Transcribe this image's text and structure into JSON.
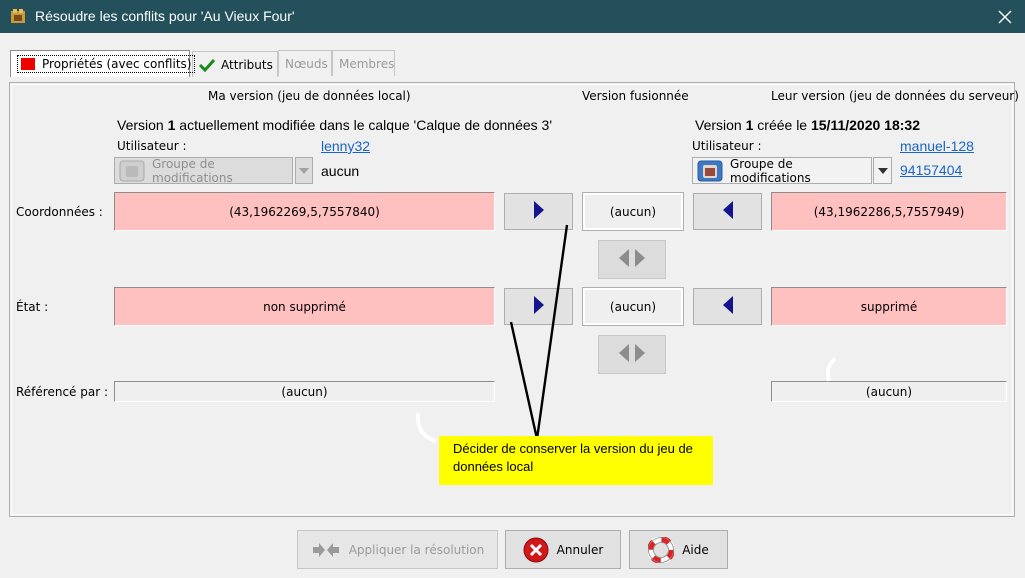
{
  "window": {
    "title": "Résoudre les conflits pour 'Au Vieux Four'",
    "app_icon": "josm-icon",
    "close_icon": "close-icon"
  },
  "tabs": [
    {
      "label": "Propriétés (avec conflits)",
      "icon": "red-square-icon",
      "state": "active"
    },
    {
      "label": "Attributs",
      "icon": "checkmark-icon",
      "state": "enabled"
    },
    {
      "label": "Nœuds",
      "state": "disabled"
    },
    {
      "label": "Membres",
      "state": "disabled"
    }
  ],
  "columns": {
    "mine": "Ma version (jeu de données local)",
    "merged": "Version fusionnée",
    "theirs": "Leur version (jeu de données du serveur)"
  },
  "mine": {
    "version_prefix": "Version",
    "version_number": "1",
    "version_suffix": "actuellement modifiée dans le calque 'Calque de données 3'",
    "user_label": "Utilisateur :",
    "user": "lenny32",
    "changeset_label": "Groupe de modifications",
    "changeset_value": "aucun"
  },
  "theirs": {
    "version_prefix": "Version",
    "version_number": "1",
    "version_middle": "créée le",
    "version_date": "15/11/2020 18:32",
    "user_label": "Utilisateur :",
    "user": "manuel-128",
    "changeset_label": "Groupe de modifications",
    "changeset_value": "94157404"
  },
  "rows": {
    "coords": {
      "label": "Coordonnées :",
      "mine": "(43,1962269,5,7557840)",
      "merged": "(aucun)",
      "theirs": "(43,1962286,5,7557949)"
    },
    "state": {
      "label": "État :",
      "mine": "non supprimé",
      "merged": "(aucun)",
      "theirs": "supprimé"
    },
    "referenced": {
      "label": "Référencé par :",
      "mine": "(aucun)",
      "theirs": "(aucun)"
    }
  },
  "tooltip": "Décider de conserver la version du jeu de données local",
  "buttons": {
    "apply": {
      "label": "Appliquer la résolution",
      "enabled": false,
      "icon": "merge-arrows-icon"
    },
    "cancel": {
      "label": "Annuler",
      "enabled": true,
      "icon": "cancel-icon"
    },
    "help": {
      "label": "Aide",
      "enabled": true,
      "icon": "lifebuoy-icon"
    }
  },
  "colors": {
    "titlebar": "#23505a",
    "conflict_field": "#ffc0c0",
    "arrow": "#14148c",
    "link": "#1a64c8",
    "tooltip": "#ffff00"
  }
}
